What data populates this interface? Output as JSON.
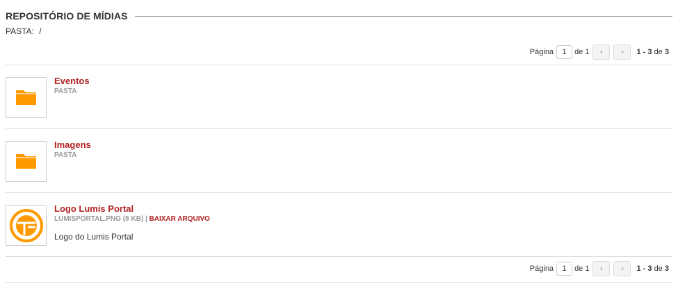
{
  "header": {
    "title": "REPOSITÓRIO DE MÍDIAS"
  },
  "folder": {
    "label": "PASTA:",
    "path": "/"
  },
  "pager": {
    "page_label": "Página",
    "page_value": "1",
    "of_label": "de 1",
    "range_label": "1 - 3",
    "range_of": "de",
    "total": "3"
  },
  "items": [
    {
      "title": "Eventos",
      "subtitle": "PASTA",
      "icon": "folder-icon"
    },
    {
      "title": "Imagens",
      "subtitle": "PASTA",
      "icon": "folder-icon"
    },
    {
      "title": "Logo Lumis Portal",
      "file_info": "LUMISPORTAL.PNG (8 KB)",
      "separator": "|",
      "download_label": "BAIXAR ARQUIVO",
      "description": "Logo do Lumis Portal",
      "icon": "lumis-logo-icon"
    }
  ],
  "colors": {
    "accent": "#b22222",
    "folder": "#ff9900",
    "muted": "#999999"
  }
}
